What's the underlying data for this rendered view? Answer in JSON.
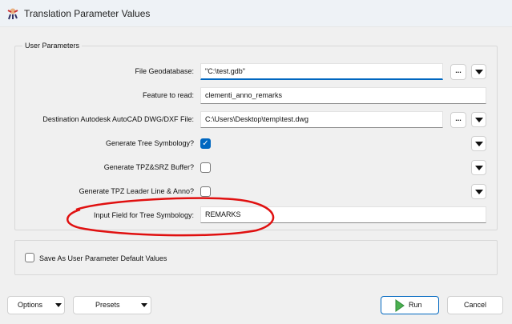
{
  "window": {
    "title": "Translation Parameter Values"
  },
  "group": {
    "title": "User Parameters"
  },
  "params": [
    {
      "label": "File Geodatabase:",
      "value": "\"C:\\test.gdb\""
    },
    {
      "label": "Feature to read:",
      "value": "clementi_anno_remarks"
    },
    {
      "label": "Destination Autodesk AutoCAD DWG/DXF File:",
      "value": "C:\\Users\\Desktop\\temp\\test.dwg"
    },
    {
      "label": "Generate Tree Symbology?",
      "checked": true
    },
    {
      "label": "Generate TPZ&SRZ Buffer?",
      "checked": false
    },
    {
      "label": "Generate TPZ Leader Line & Anno?",
      "checked": false
    },
    {
      "label": "Input Field for Tree Symbology:",
      "value": "REMARKS"
    }
  ],
  "browse_label": "...",
  "save_defaults": {
    "label": "Save As User Parameter Default Values",
    "checked": false
  },
  "buttons": {
    "options": "Options",
    "presets": "Presets",
    "run": "Run",
    "cancel": "Cancel"
  },
  "annotation_color": "#e01010"
}
